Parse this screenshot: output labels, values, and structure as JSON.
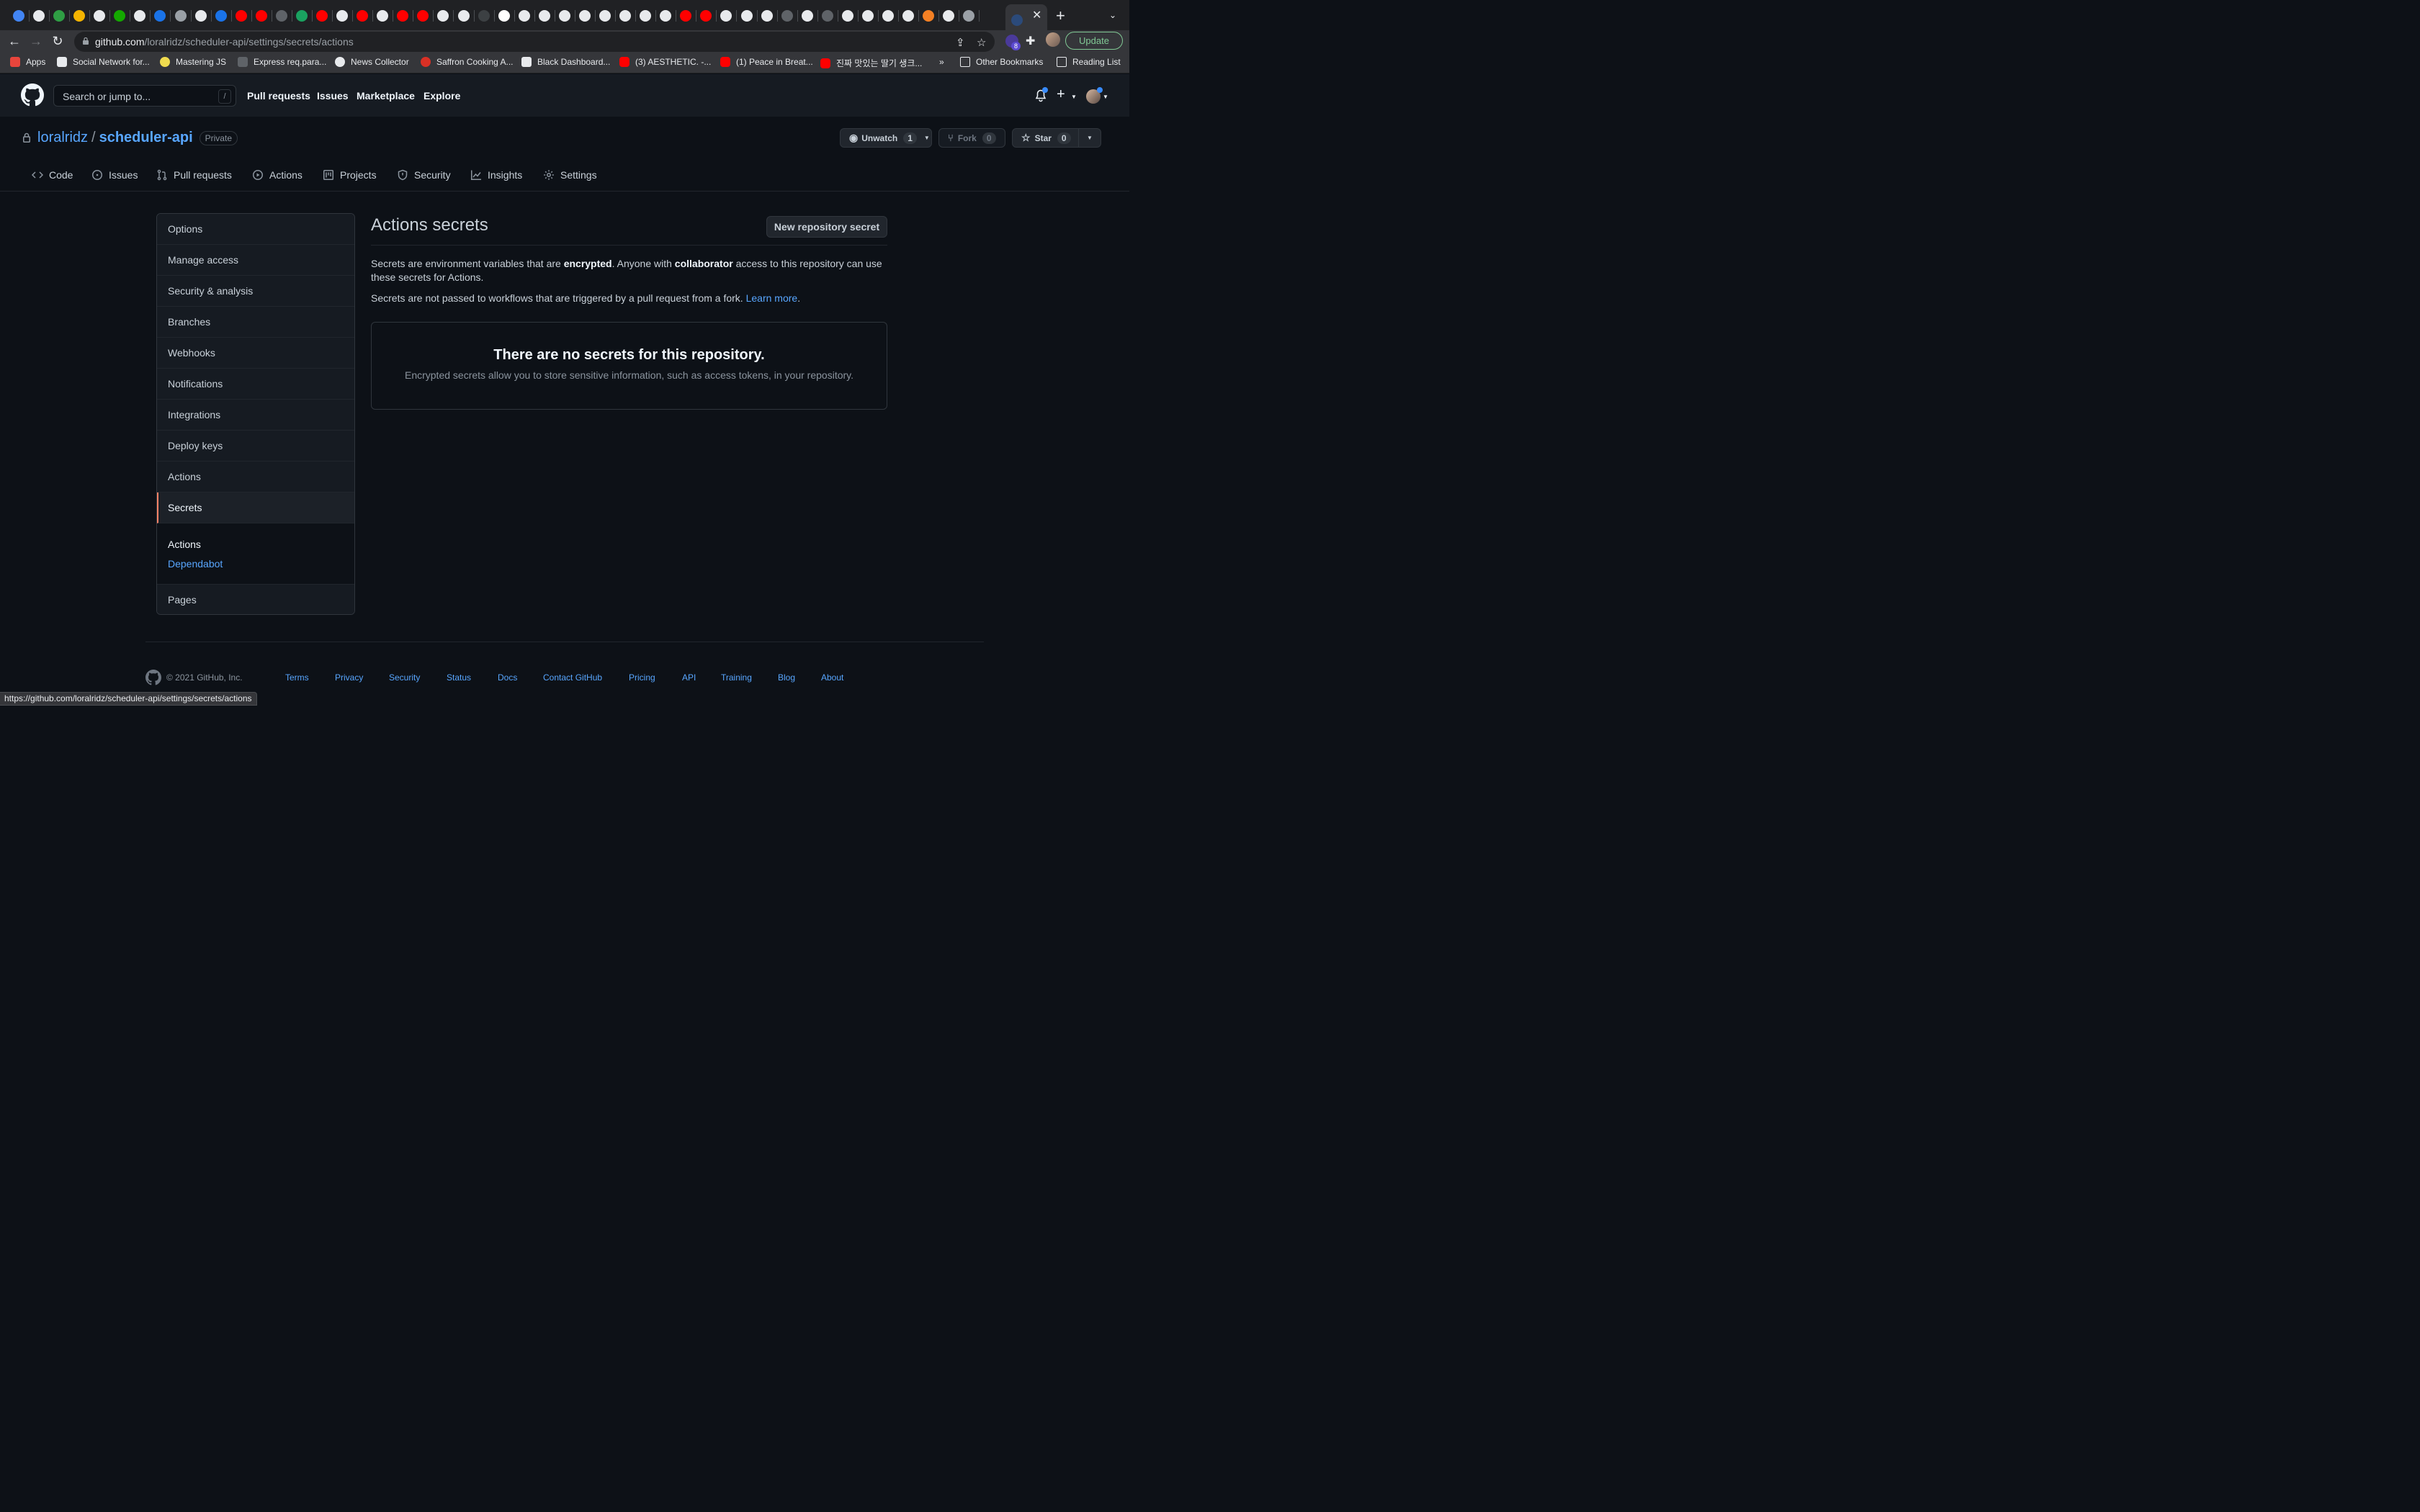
{
  "browser": {
    "url_domain": "github.com",
    "url_path": "/loralridz/scheduler-api/settings/secrets/actions",
    "update_label": "Update",
    "extension_badge": "8",
    "close_tab_glyph": "✕",
    "new_tab_glyph": "+",
    "bookmarks": [
      {
        "label": "Apps",
        "icon": "apps-grid-icon",
        "color": "#e8453c"
      },
      {
        "label": "Social Network for...",
        "icon": "codepen-icon",
        "color": "#e8eaed"
      },
      {
        "label": "Mastering JS",
        "icon": "mastering-js-icon",
        "color": "#f0db4f"
      },
      {
        "label": "Express req.para...",
        "icon": "vs-icon",
        "color": "#5f6368"
      },
      {
        "label": "News Collector",
        "icon": "globe-icon",
        "color": "#e8eaed"
      },
      {
        "label": "Saffron Cooking A...",
        "icon": "saffron-icon",
        "color": "#d93025"
      },
      {
        "label": "Black Dashboard...",
        "icon": "dashboard-icon",
        "color": "#e8eaed"
      },
      {
        "label": "(3) AESTHETIC. -...",
        "icon": "youtube-icon",
        "color": "#ff0000"
      },
      {
        "label": "(1) Peace in Breat...",
        "icon": "youtube-icon",
        "color": "#ff0000"
      },
      {
        "label": "진짜 맛있는 딸기 생크...",
        "icon": "youtube-icon",
        "color": "#ff0000"
      }
    ],
    "more_bookmarks": "»",
    "other_bookmarks": "Other Bookmarks",
    "reading_list": "Reading List",
    "status_url": "https://github.com/loralridz/scheduler-api/settings/secrets/actions"
  },
  "header": {
    "search_placeholder": "Search or jump to...",
    "search_shortcut": "/",
    "nav": [
      "Pull requests",
      "Issues",
      "Marketplace",
      "Explore"
    ]
  },
  "repo": {
    "owner": "loralridz",
    "separator": "/",
    "name": "scheduler-api",
    "visibility": "Private",
    "watch_label": "Unwatch",
    "watch_count": "1",
    "fork_label": "Fork",
    "fork_count": "0",
    "star_label": "Star",
    "star_count": "0",
    "tabs": [
      "Code",
      "Issues",
      "Pull requests",
      "Actions",
      "Projects",
      "Security",
      "Insights",
      "Settings"
    ]
  },
  "sidebar": {
    "items": [
      "Options",
      "Manage access",
      "Security & analysis",
      "Branches",
      "Webhooks",
      "Notifications",
      "Integrations",
      "Deploy keys",
      "Actions",
      "Secrets"
    ],
    "selected": "Secrets",
    "sub_heading": "Actions",
    "sub_link": "Dependabot",
    "last_item": "Pages"
  },
  "main": {
    "title": "Actions secrets",
    "new_button": "New repository secret",
    "desc1_a": "Secrets are environment variables that are ",
    "desc1_b": "encrypted",
    "desc1_c": ". Anyone with ",
    "desc1_d": "collaborator",
    "desc1_e": " access to this repository can use these secrets for Actions.",
    "desc2": "Secrets are not passed to workflows that are triggered by a pull request from a fork. ",
    "learn_more": "Learn more",
    "desc2_end": ".",
    "empty_title": "There are no secrets for this repository.",
    "empty_desc": "Encrypted secrets allow you to store sensitive information, such as access tokens, in your repository."
  },
  "footer": {
    "copyright": "© 2021 GitHub, Inc.",
    "links": [
      "Terms",
      "Privacy",
      "Security",
      "Status",
      "Docs",
      "Contact GitHub",
      "Pricing",
      "API",
      "Training",
      "Blog",
      "About"
    ]
  },
  "colors": {
    "bg": "#0d1117",
    "header_bg": "#161b22",
    "link": "#58a6ff",
    "selected_accent": "#f78166",
    "border": "#30363d"
  }
}
